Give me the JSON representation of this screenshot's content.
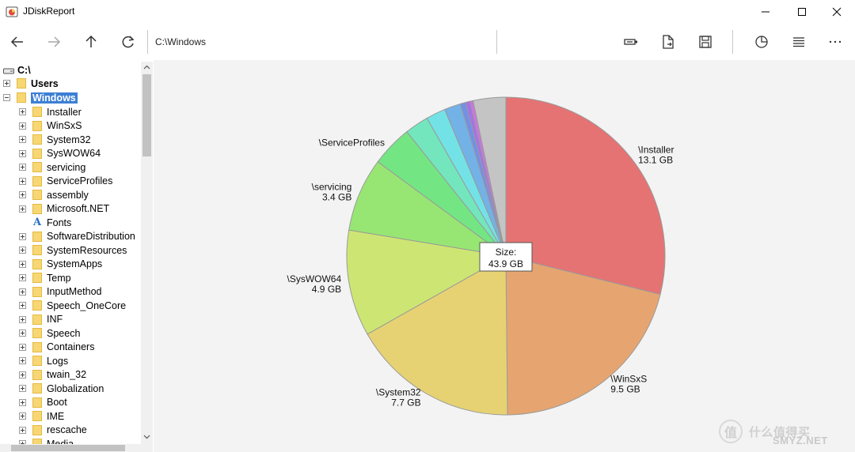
{
  "window": {
    "title": "JDiskReport",
    "controls": [
      "minimize",
      "maximize",
      "close"
    ]
  },
  "toolbar": {
    "path": "C:\\Windows",
    "left_buttons": [
      "back-icon",
      "forward-icon",
      "up-icon",
      "refresh-icon"
    ],
    "right_buttons": [
      "scan-icon",
      "export-icon",
      "save-icon",
      "pie-chart-icon",
      "list-view-icon",
      "more-icon"
    ]
  },
  "tree": {
    "root": "C:\\",
    "top_items": [
      {
        "label": "Users",
        "expanded": false
      },
      {
        "label": "Windows",
        "expanded": true,
        "selected": true
      }
    ],
    "children": [
      {
        "label": "Installer",
        "icon": "folder"
      },
      {
        "label": "WinSxS",
        "icon": "folder"
      },
      {
        "label": "System32",
        "icon": "folder"
      },
      {
        "label": "SysWOW64",
        "icon": "folder"
      },
      {
        "label": "servicing",
        "icon": "folder"
      },
      {
        "label": "ServiceProfiles",
        "icon": "folder"
      },
      {
        "label": "assembly",
        "icon": "folder"
      },
      {
        "label": "Microsoft.NET",
        "icon": "folder"
      },
      {
        "label": "Fonts",
        "icon": "font"
      },
      {
        "label": "SoftwareDistribution",
        "icon": "folder"
      },
      {
        "label": "SystemResources",
        "icon": "folder"
      },
      {
        "label": "SystemApps",
        "icon": "folder"
      },
      {
        "label": "Temp",
        "icon": "folder"
      },
      {
        "label": "InputMethod",
        "icon": "folder"
      },
      {
        "label": "Speech_OneCore",
        "icon": "folder"
      },
      {
        "label": "INF",
        "icon": "folder"
      },
      {
        "label": "Speech",
        "icon": "folder"
      },
      {
        "label": "Containers",
        "icon": "folder"
      },
      {
        "label": "Logs",
        "icon": "folder"
      },
      {
        "label": "twain_32",
        "icon": "folder"
      },
      {
        "label": "Globalization",
        "icon": "folder"
      },
      {
        "label": "Boot",
        "icon": "folder"
      },
      {
        "label": "IME",
        "icon": "folder"
      },
      {
        "label": "rescache",
        "icon": "folder"
      },
      {
        "label": "Media",
        "icon": "folder"
      }
    ]
  },
  "chart_data": {
    "type": "pie",
    "center_label": {
      "title": "Size:",
      "value": "43.9 GB"
    },
    "total_gb": 43.9,
    "slices": [
      {
        "name": "\\Installer",
        "value_gb": 13.1,
        "label_value": "13.1 GB",
        "color": "#e57373"
      },
      {
        "name": "\\WinSxS",
        "value_gb": 9.5,
        "label_value": "9.5 GB",
        "color": "#e6a570"
      },
      {
        "name": "\\System32",
        "value_gb": 7.7,
        "label_value": "7.7 GB",
        "color": "#e6d273"
      },
      {
        "name": "\\SysWOW64",
        "value_gb": 4.9,
        "label_value": "4.9 GB",
        "color": "#cde673"
      },
      {
        "name": "\\servicing",
        "value_gb": 3.4,
        "label_value": "3.4 GB",
        "color": "#97e673"
      },
      {
        "name": "\\ServiceProfiles",
        "value_gb": 1.9,
        "label_value": "",
        "color": "#73e683"
      },
      {
        "name": "",
        "value_gb": 1.1,
        "label_value": "",
        "color": "#73e6bd"
      },
      {
        "name": "",
        "value_gb": 0.9,
        "label_value": "",
        "color": "#73e2e6"
      },
      {
        "name": "",
        "value_gb": 0.75,
        "label_value": "",
        "color": "#73b2e6"
      },
      {
        "name": "",
        "value_gb": 0.25,
        "label_value": "",
        "color": "#7390e6"
      },
      {
        "name": "",
        "value_gb": 0.2,
        "label_value": "",
        "color": "#a473e6"
      },
      {
        "name": "",
        "value_gb": 0.15,
        "label_value": "",
        "color": "#d073e6"
      },
      {
        "name": "",
        "value_gb": 1.5,
        "label_value": "",
        "color": "#c4c4c4"
      }
    ]
  },
  "watermark": {
    "text": "什么值得买",
    "suffix": "SMYZ.NET",
    "logo_char": "值"
  }
}
